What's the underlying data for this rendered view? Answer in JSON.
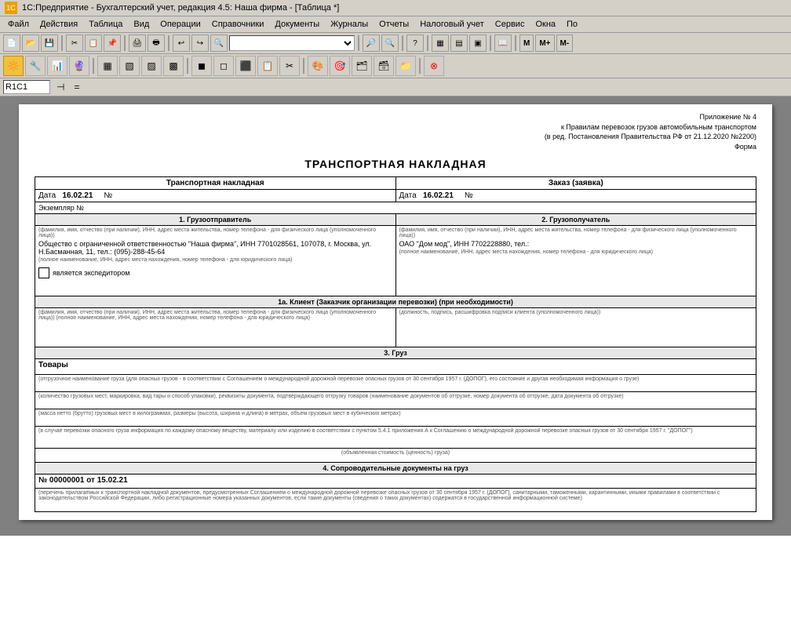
{
  "window": {
    "title": "1С:Предприятие - Бухгалтерский учет, редакция 4.5: Наша фирма - [Таблица *]"
  },
  "menu": {
    "items": [
      "Файл",
      "Действия",
      "Таблица",
      "Вид",
      "Операции",
      "Справочники",
      "Документы",
      "Журналы",
      "Отчеты",
      "Налоговый учет",
      "Сервис",
      "Окна",
      "По"
    ]
  },
  "formula_bar": {
    "cell_ref": "R1C1",
    "equals": "="
  },
  "document": {
    "annotation_line1": "Приложение № 4",
    "annotation_line2": "к Правилам перевозок грузов автомобильным транспортом",
    "annotation_line3": "(в ред. Постановления Правительства РФ от 21.12.2020 №2200)",
    "annotation_line4": "Форма",
    "title": "ТРАНСПОРТНАЯ НАКЛАДНАЯ",
    "left_header": "Транспортная накладная",
    "right_header": "Заказ (заявка)",
    "date_label": "Дата",
    "date_value": "16.02.21",
    "number_label": "№",
    "date_label2": "Дата",
    "date_value2": "16.02.21",
    "number_label2": "№",
    "copy_label": "Экземпляр №",
    "section1_title": "1. Грузоотправитель",
    "section2_title": "2. Грузополучатель",
    "sender_field_hint": "(фамилия, имя, отчество (при наличии), ИНН, адрес места жительства, номер телефона - для физического лица (уполномоченного лица))",
    "sender_value": "Общество с ограниченной ответственностью \"Наша фирма\", ИНН 7701028561, 107078, г. Москва, ул. Н.Басманная, 11, тел.: (095)-288-45-64",
    "sender_legal_hint": "(полное наименование, ИНН, адрес места нахождения, номер телефона - для юридического лица)",
    "expeditor_label": "является экспедитором",
    "receiver_field_hint": "(фамилия, имя, отчество (при наличии), ИНН, адрес места жительства, номер телефона - для физического лица (уполномоченного лица))",
    "receiver_value": "ОАО \"Дом мод\", ИНН 7702228880, тел.:",
    "receiver_legal_hint": "(полное наименование, ИНН, адрес места нахождения, номер телефона - для юридического лица)",
    "section1a_title": "1а. Клиент (Заказчик организации перевозки) (при необходимости)",
    "client_field_hint": "(фамилия, имя, отчество (при наличии), ИНН, адрес места жительства, номер телефона - для физического лица (уполномоченного лица)) (полное наименование, ИНН, адрес места нахождения, номер телефона - для юридического лица)",
    "client_sign_hint": "(должность, подпись, расшифровка подписи клиента (уполномоченного лица))",
    "section3_title": "3. Груз",
    "goods_label": "Товары",
    "goods_hint1": "(отгрузочное наименование груза (для опасных грузов - в соответствии с Соглашением о международной дорожной перевозке опасных грузов от 30 сентября 1957 г. (ДОПОГ), его состояние и другая необходимая информация о грузе)",
    "goods_hint2": "(количество грузовых мест, маркировка, вид тары и способ упаковки), реквизиты документа, подтверждающего отгрузку товаров (наименование документов об отгрузке, номер документа об отгрузке, дата документа об отгрузке)",
    "goods_hint3": "(масса нетто (брутто) грузовых мест в килограммах, размеры (высота, ширина и длина) в метрах, объем грузовых мест в кубических метрах)",
    "goods_hint4": "(в случае перевозки опасного груза информация по каждому опасному веществу, материалу или изделию в соответствии с пунктом 5.4.1 приложения А к Соглашению о международной дорожной перевозке опасных грузов от 30 сентября 1957 г. \"ДОПОГ\")",
    "goods_hint5": "(объявленная стоимость (ценность) груза)",
    "section4_title": "4. Сопроводительные документы на груз",
    "doc_number": "№ 00000001 от 15.02.21",
    "doc_hint": "(перечень прилагаемых к транспортной накладной документов, предусмотренных Соглашением о международной дорожной перевозке опасных грузов от 30 сентября 1957 г. (ДОПОГ), санитарными, таможенными, карантинными, иными правилами в соответствии с законодательством Российской Федерации, либо регистрационные номера указанных документов, если такие документы (сведения о таких документах) содержатся в государственной информационной системе)"
  }
}
